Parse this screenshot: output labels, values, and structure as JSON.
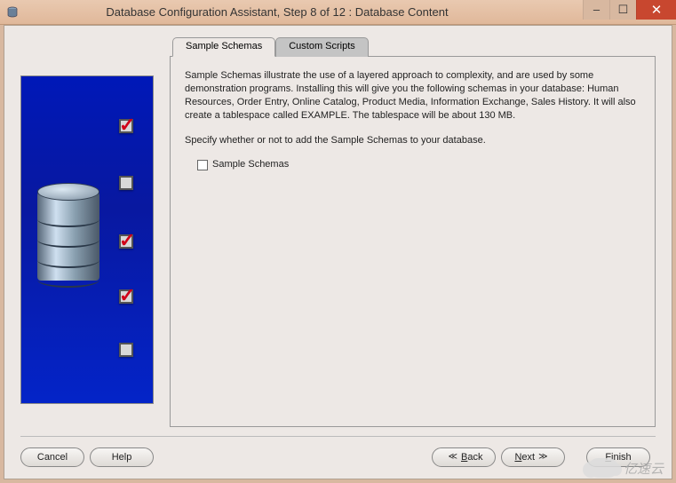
{
  "window": {
    "title": "Database Configuration Assistant, Step 8 of 12 : Database Content"
  },
  "tabs": {
    "sample": "Sample Schemas",
    "custom": "Custom Scripts"
  },
  "body": {
    "description": "Sample Schemas illustrate the use of a layered approach to complexity, and are used by some demonstration programs. Installing this will give you the following schemas in your database: Human Resources, Order Entry, Online Catalog, Product Media, Information Exchange, Sales History. It will also create a tablespace called EXAMPLE. The tablespace will be about 130 MB.",
    "specify": "Specify whether or not to add the Sample Schemas to your database.",
    "checkbox_label": "Sample Schemas",
    "checkbox_checked": false
  },
  "footer": {
    "cancel": "Cancel",
    "help": "Help",
    "back": "Back",
    "next": "Next",
    "finish": "Finish"
  },
  "watermark": "亿速云"
}
